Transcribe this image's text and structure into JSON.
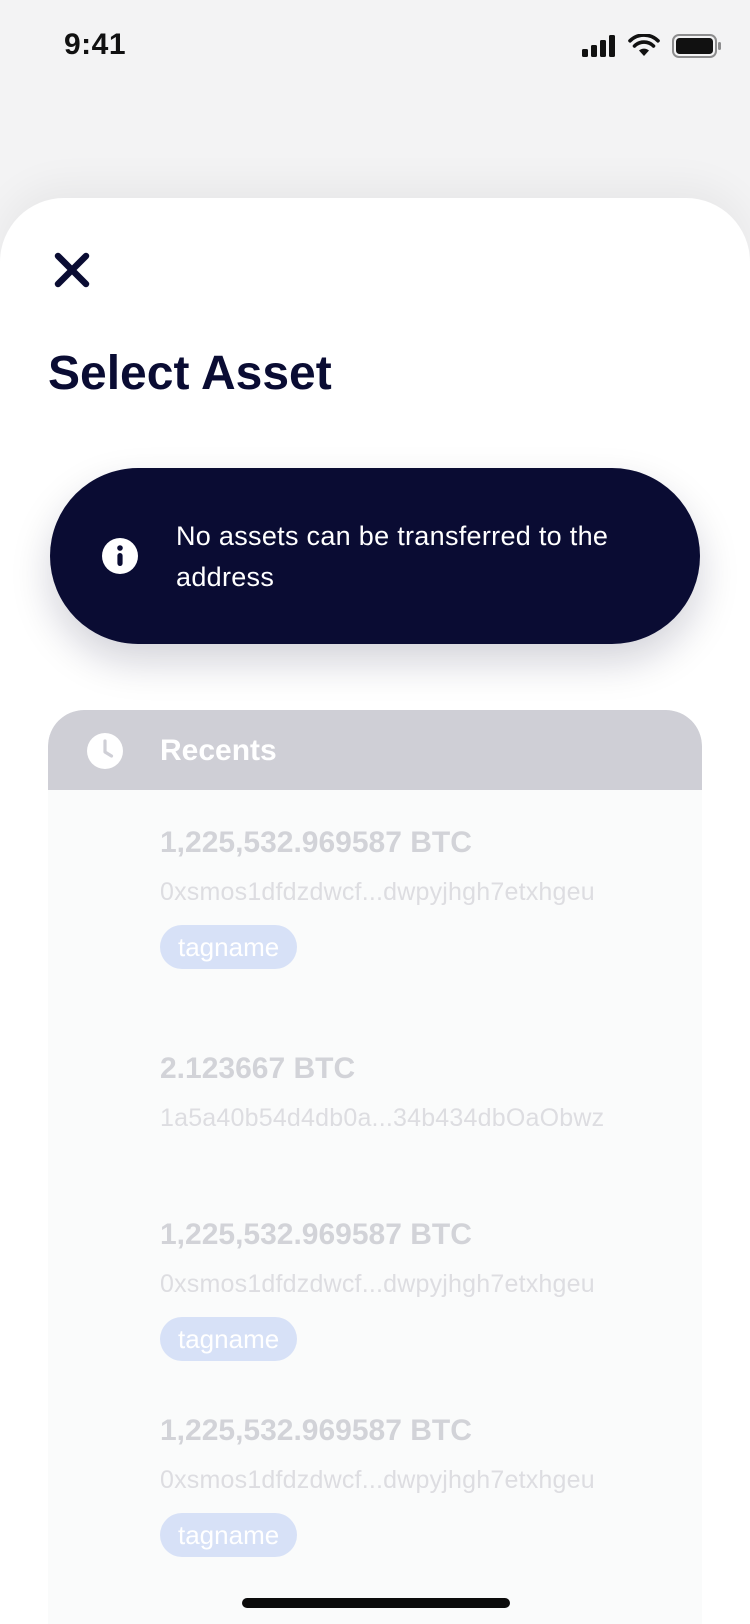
{
  "status_bar": {
    "time": "9:41"
  },
  "sheet": {
    "title": "Select Asset"
  },
  "banner": {
    "message": "No assets can be transferred to the address"
  },
  "recents": {
    "title": "Recents",
    "items": [
      {
        "amount": "1,225,532.969587 BTC",
        "address": "0xsmos1dfdzdwcf...dwpyjhgh7etxhgeu",
        "tag": "tagname"
      },
      {
        "amount": "2.123667 BTC",
        "address": "1a5a40b54d4db0a...34b434dbOaObwz",
        "tag": ""
      },
      {
        "amount": "1,225,532.969587 BTC",
        "address": "0xsmos1dfdzdwcf...dwpyjhgh7etxhgeu",
        "tag": "tagname"
      },
      {
        "amount": "1,225,532.969587 BTC",
        "address": "0xsmos1dfdzdwcf...dwpyjhgh7etxhgeu",
        "tag": "tagname"
      }
    ]
  },
  "colors": {
    "navy": "#0a0c33",
    "recents_header": "#cfcfd6",
    "tag_background": "#d7e1f7",
    "muted_text": "#d2d3d8"
  },
  "icons": [
    "signal-icon",
    "wifi-icon",
    "battery-icon",
    "close-icon",
    "info-icon",
    "clock-icon"
  ]
}
